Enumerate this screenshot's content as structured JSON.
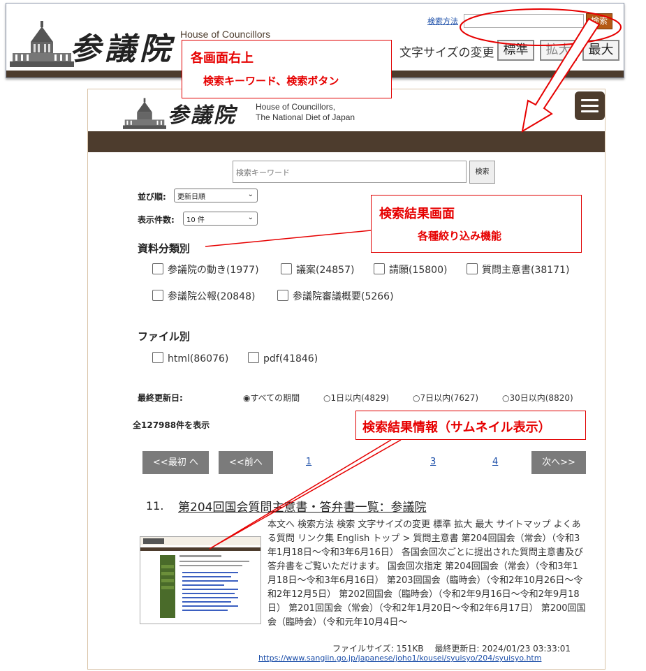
{
  "top_header": {
    "logo_text": "参議院",
    "house_en": "House of Councillors",
    "search_method_link": "検索方法",
    "search_button": "検索",
    "fontsize_label": "文字サイズの変更",
    "fontsize_buttons": [
      "標準",
      "拡大",
      "最大"
    ]
  },
  "site_header": {
    "logo_text": "参議院",
    "house_en_line1": "House of Councillors,",
    "house_en_line2": "The National Diet of Japan",
    "menu_icon": "hamburger-menu-icon"
  },
  "search": {
    "placeholder": "検索キーワード",
    "button": "検索"
  },
  "sort": {
    "label": "並び順:",
    "selected": "更新日順"
  },
  "count": {
    "label": "表示件数:",
    "selected": "10 件"
  },
  "category_filter": {
    "heading": "資料分類別",
    "options": [
      "参議院の動き(1977)",
      "議案(24857)",
      "請願(15800)",
      "質問主意書(38171)",
      "参議院公報(20848)",
      "参議院審議概要(5266)"
    ]
  },
  "file_filter": {
    "heading": "ファイル別",
    "options": [
      "html(86076)",
      "pdf(41846)"
    ]
  },
  "date_filter": {
    "label": "最終更新日:",
    "options": [
      "すべての期間",
      "1日以内(4829)",
      "7日以内(7627)",
      "30日以内(8820)"
    ],
    "selected_index": 0
  },
  "total_text": "全127988件を表示",
  "pagination": {
    "first": "<<最初 へ",
    "prev": "<<前へ",
    "pages": [
      "1",
      "3",
      "4"
    ],
    "next": "次へ>>"
  },
  "result": {
    "number": "11.",
    "title": "第204回国会質問主意書・答弁書一覧：参議院",
    "snippet": "本文へ 検索方法 検索 文字サイズの変更 標準 拡大 最大 サイトマップ よくある質問 リンク集 English トップ > 質問主意書 第204回国会（常会）（令和3年1月18日～令和3年6月16日） 各国会回次ごとに提出された質問主意書及び答弁書をご覧いただけます。 国会回次指定 第204回国会（常会）（令和3年1月18日～令和3年6月16日） 第203回国会（臨時会）（令和2年10月26日～令和2年12月5日） 第202回国会（臨時会）（令和2年9月16日～令和2年9月18日） 第201回国会（常会）（令和2年1月20日～令和2年6月17日） 第200回国会（臨時会）（令和元年10月4日～",
    "meta": "ファイルサイズ: 151KB　 最終更新日: 2024/01/23 03:33:01",
    "url": "https://www.sangiin.go.jp/japanese/joho1/kousei/syuisyo/204/syuisyo.htm"
  },
  "annotations": {
    "header_callout_title": "各画面右上",
    "header_callout_sub": "検索キーワード、検索ボタン",
    "results_callout_title": "検索結果画面",
    "results_callout_sub": "各種絞り込み機能",
    "info_callout_title": "検索結果情報（サムネイル表示）",
    "color": "#e60000"
  }
}
